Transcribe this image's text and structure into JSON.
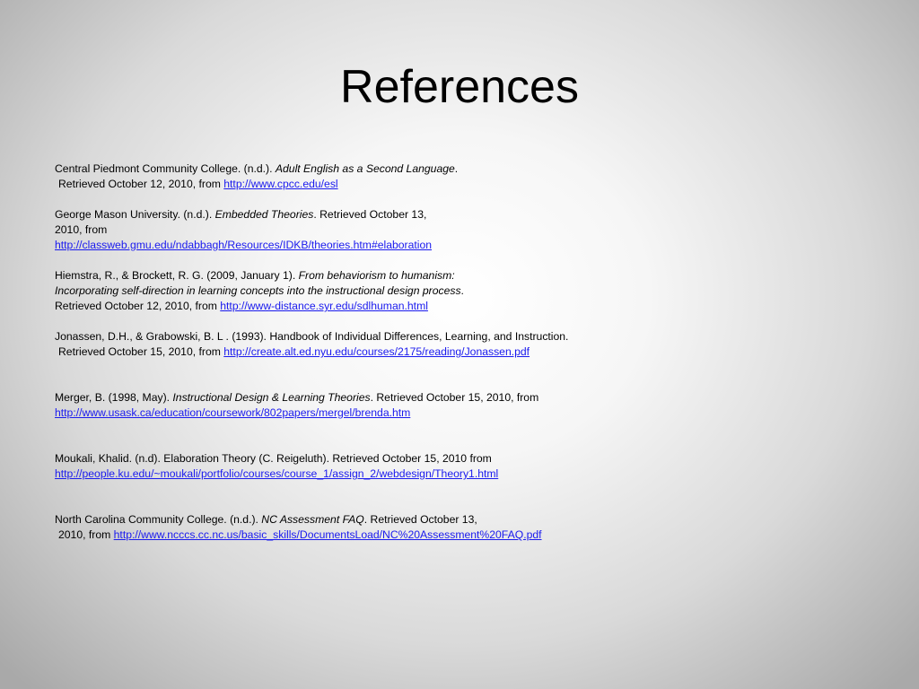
{
  "slide": {
    "title": "References"
  },
  "references": [
    {
      "r1_a": "Central Piedmont Community College. (n.d.). ",
      "r1_b": "Adult English as a Second  Language",
      "r1_c": ".",
      "r1_d": "Retrieved October 12, 2010, from ",
      "r1_link": "http://www.cpcc.edu/esl"
    },
    {
      "r2_a": "George Mason University. (n.d.). ",
      "r2_b": "Embedded Theories",
      "r2_c": ". Retrieved October 13,",
      "r2_d": "2010, from",
      "r2_link": "http://classweb.gmu.edu/ndabbagh/Resources/IDKB/theories.htm#elaboration"
    },
    {
      "r3_a": "Hiemstra, R., & Brockett, R. G. (2009, January 1). ",
      "r3_b": "From behaviorism to humanism:",
      "r3_c": "Incorporating self-direction in learning concepts into the instructional design process",
      "r3_d": ".",
      "r3_e": "Retrieved October 12, 2010, from ",
      "r3_link": "http://www-distance.syr.edu/sdlhuman.html"
    },
    {
      "r4_a": "Jonassen, D.H., & Grabowski, B. L . (1993). Handbook of Individual Differences, Learning, and Instruction.",
      "r4_b": "Retrieved October 15, 2010, from ",
      "r4_link": "http://create.alt.ed.nyu.edu/courses/2175/reading/Jonassen.pdf"
    },
    {
      "r5_a": "Merger, B. (1998, May). ",
      "r5_b": "Instructional Design & Learning Theories",
      "r5_c": ". Retrieved October 15, 2010, from",
      "r5_link": "http://www.usask.ca/education/coursework/802papers/mergel/brenda.htm"
    },
    {
      "r6_a": "Moukali, Khalid. (n.d). Elaboration Theory (C. Reigeluth). Retrieved October 15, 2010 from",
      "r6_link": "http://people.ku.edu/~moukali/portfolio/courses/course_1/assign_2/webdesign/Theory1.html"
    },
    {
      "r7_a": "North Carolina Community College. (n.d.). ",
      "r7_b": "NC Assessment FAQ",
      "r7_c": ". Retrieved October 13,",
      "r7_d": "2010, from ",
      "r7_link": "http://www.ncccs.cc.nc.us/basic_skills/DocumentsLoad/NC%20Assessment%20FAQ.pdf"
    }
  ]
}
